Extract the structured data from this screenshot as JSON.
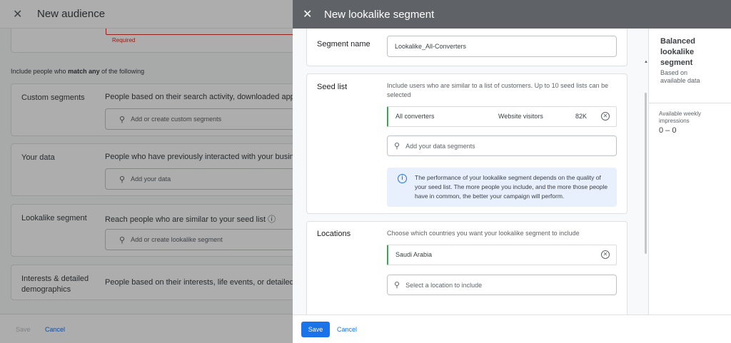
{
  "background": {
    "title": "New audience",
    "required_text": "Required",
    "include_prefix": "Include people who ",
    "include_bold": "match any",
    "include_suffix": " of the following",
    "sections": [
      {
        "label": "Custom segments",
        "description": "People based on their search activity, downloaded apps, ...",
        "placeholder": "Add or create custom segments"
      },
      {
        "label": "Your data",
        "description": "People who have previously interacted with your business",
        "placeholder": "Add your data"
      },
      {
        "label": "Lookalike segment",
        "description": "Reach people who are similar to your seed list",
        "placeholder": "Add or create lookalike segment"
      },
      {
        "label": "Interests & detailed demographics",
        "description": "People based on their interests, life events, or detailed d..."
      }
    ],
    "save_label": "Save",
    "cancel_label": "Cancel"
  },
  "drawer": {
    "title": "New lookalike segment",
    "segment_name": {
      "label": "Segment name",
      "value": "Lookalike_All-Converters"
    },
    "seed_list": {
      "label": "Seed list",
      "hint": "Include users who are similar to a list of customers. Up to 10 seed lists can be selected",
      "selected": {
        "name": "All converters",
        "type": "Website visitors",
        "size": "82K"
      },
      "search_placeholder": "Add your data segments",
      "info": "The performance of your lookalike segment depends on the quality of your seed list. The more people you include, and the more those people have in common, the better your campaign will perform."
    },
    "locations": {
      "label": "Locations",
      "hint": "Choose which countries you want your lookalike segment to include",
      "selected": "Saudi Arabia",
      "search_placeholder": "Select a location to include"
    },
    "side": {
      "title": "Balanced lookalike segment",
      "subtitle": "Based on available data",
      "impressions_label": "Available weekly impressions",
      "impressions_range": "0 – 0"
    },
    "save_label": "Save",
    "cancel_label": "Cancel"
  }
}
